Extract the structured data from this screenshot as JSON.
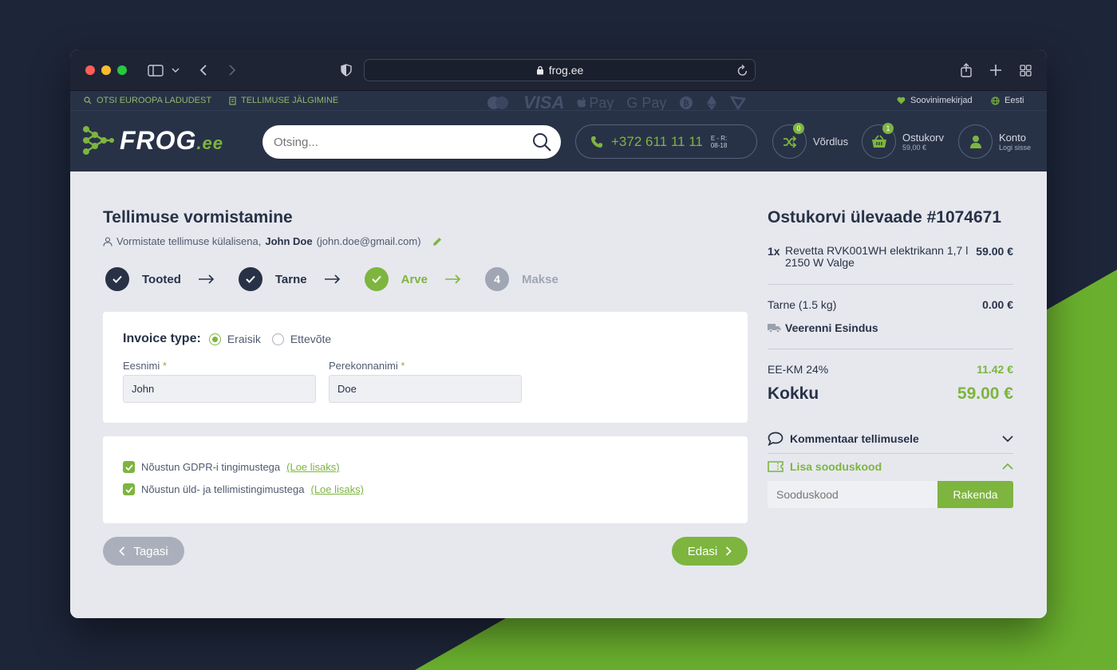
{
  "browser": {
    "url": "frog.ee"
  },
  "topbar": {
    "eu_warehouses": "OTSI EUROOPA LADUDEST",
    "order_tracking": "TELLIMUSE JÄLGIMINE",
    "wishlist": "Soovinimekirjad",
    "language": "Eesti",
    "payment_logos": [
      "mastercard-logo",
      "VISA",
      "Pay",
      "G Pay",
      "bitcoin-logo",
      "ethereum-logo",
      "tron-logo"
    ]
  },
  "header": {
    "logo_main": "FROG",
    "logo_suffix": ".ee",
    "search_placeholder": "Otsing...",
    "phone": "+372 611 11 11",
    "phone_hours_days": "E - R:",
    "phone_hours_time": "08-18",
    "compare_label": "Võrdlus",
    "compare_count": "0",
    "cart_label": "Ostukorv",
    "cart_amount": "59,00 €",
    "cart_count": "1",
    "account_label": "Konto",
    "account_sub": "Logi sisse"
  },
  "checkout": {
    "title": "Tellimuse vormistamine",
    "guest_prefix": "Vormistate tellimuse külalisena,",
    "guest_name": "John Doe",
    "guest_email": "(john.doe@gmail.com)",
    "steps": [
      {
        "label": "Tooted",
        "state": "done"
      },
      {
        "label": "Tarne",
        "state": "done"
      },
      {
        "label": "Arve",
        "state": "active"
      },
      {
        "label": "Makse",
        "state": "pending",
        "number": "4"
      }
    ],
    "invoice_type_label": "Invoice type:",
    "invoice_options": [
      "Eraisik",
      "Ettevõte"
    ],
    "invoice_selected": "Eraisik",
    "first_name_label": "Eesnimi",
    "first_name_value": "John",
    "last_name_label": "Perekonnanimi",
    "last_name_value": "Doe",
    "required_mark": "*",
    "gdpr_text": "Nõustun GDPR-i tingimustega",
    "terms_text": "Nõustun üld- ja tellimistingimustega",
    "read_more": "(Loe lisaks)",
    "back_label": "Tagasi",
    "next_label": "Edasi"
  },
  "summary": {
    "title": "Ostukorvi ülevaade #1074671",
    "item_qty": "1x",
    "item_name": "Revetta RVK001WH elektrikann 1,7 l 2150 W Valge",
    "item_price": "59.00 €",
    "shipping_label": "Tarne (1.5 kg)",
    "shipping_price": "0.00 €",
    "shipping_method": "Veerenni Esindus",
    "vat_label": "EE-KM 24%",
    "vat_value": "11.42 €",
    "total_label": "Kokku",
    "total_value": "59.00 €",
    "comment_label": "Kommentaar tellimusele",
    "coupon_label": "Lisa sooduskood",
    "coupon_placeholder": "Sooduskood",
    "apply_label": "Rakenda"
  },
  "colors": {
    "accent": "#7db53f",
    "navy": "#283247",
    "page_bg": "#1d2538",
    "content_bg": "#e6e8ee"
  }
}
